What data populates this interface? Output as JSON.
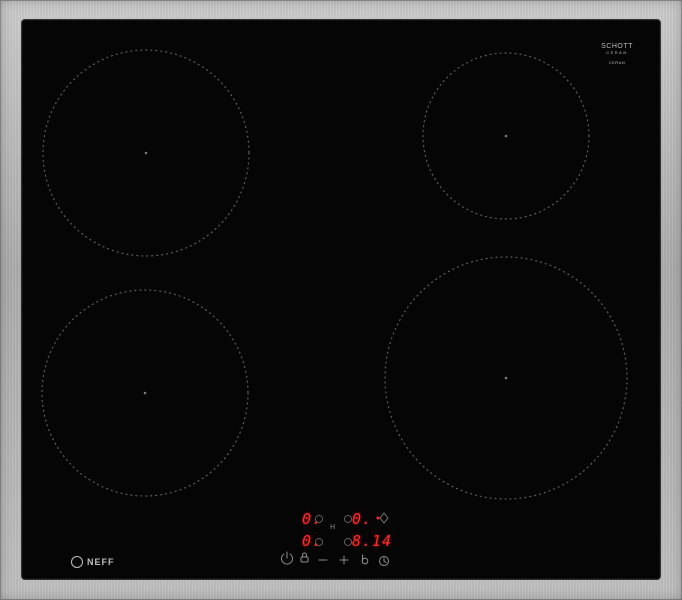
{
  "brand": {
    "logo": "NEFF",
    "glass_brand_line1": "SCHOTT",
    "glass_brand_line2": "CERAN",
    "glass_brand_line3": "CERAN",
    "glass_brand_line4": ""
  },
  "controls": {
    "zone_display_left_top": "0.",
    "zone_display_right_top": "0.",
    "zone_display_left_bottom": "0.",
    "zone_display_right_bottom": "8.",
    "timer_display": "14",
    "hl_indicator": "H",
    "power_icon": "power-icon",
    "lock_icon": "lock-icon",
    "minus_icon": "minus-icon",
    "plus_icon": "plus-icon",
    "childlock_icon": "child-lock-icon",
    "timer_icon": "timer-icon"
  },
  "colors": {
    "glass": "#050505",
    "frame": "#b5b5b5",
    "display_red": "#ff2b2b",
    "zone_dots": "#5c5c5c"
  }
}
